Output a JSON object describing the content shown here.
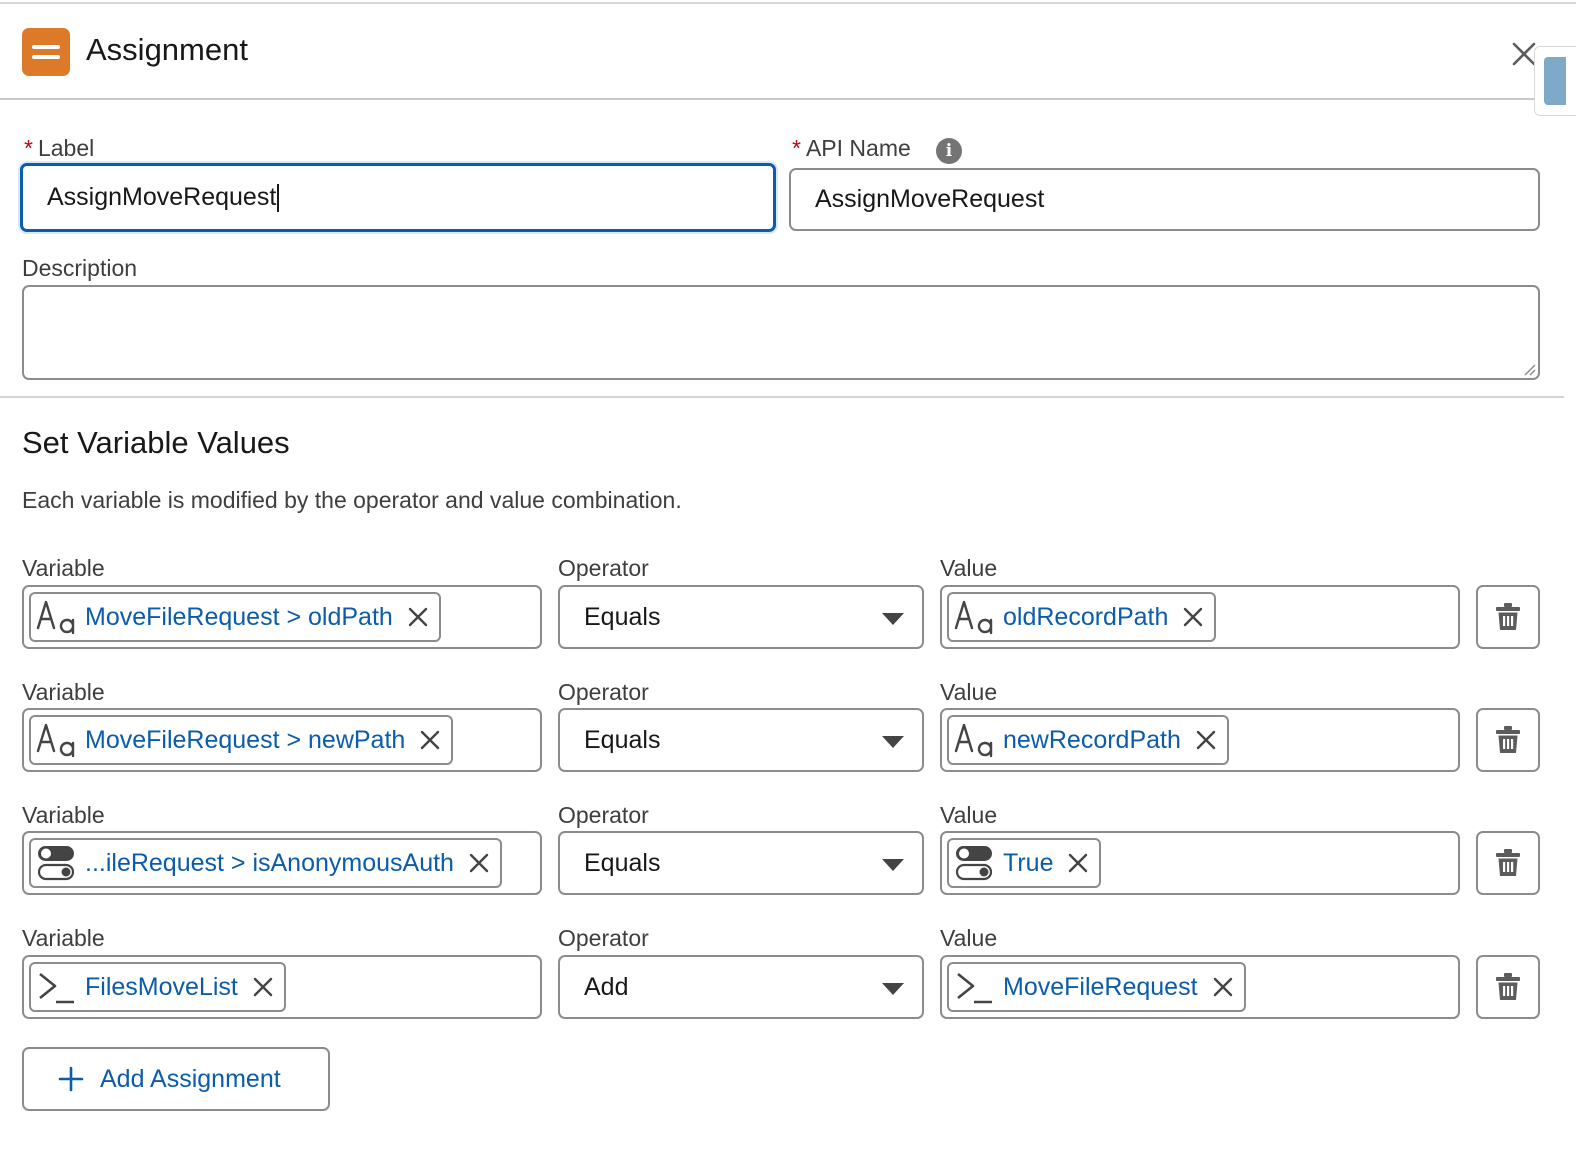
{
  "header": {
    "title": "Assignment",
    "icon": "assignment-icon",
    "accent_color": "#dd7a2a",
    "close_icon": "close-icon"
  },
  "form": {
    "label": {
      "label": "Label",
      "required_mark": "*",
      "value": "AssignMoveRequest"
    },
    "api_name": {
      "label": "API Name",
      "required_mark": "*",
      "value": "AssignMoveRequest",
      "info_icon": "info-icon"
    },
    "description": {
      "label": "Description",
      "value": ""
    }
  },
  "section": {
    "title": "Set Variable Values",
    "description": "Each variable is modified by the operator and value combination."
  },
  "assignments": [
    {
      "variable_label": "Variable",
      "variable_value": "MoveFileRequest > oldPath",
      "variable_icon": "text-icon",
      "operator_label": "Operator",
      "operator_value": "Equals",
      "value_label": "Value",
      "value_value": "oldRecordPath",
      "value_icon": "text-icon"
    },
    {
      "variable_label": "Variable",
      "variable_value": "MoveFileRequest > newPath",
      "variable_icon": "text-icon",
      "operator_label": "Operator",
      "operator_value": "Equals",
      "value_label": "Value",
      "value_value": "newRecordPath",
      "value_icon": "text-icon"
    },
    {
      "variable_label": "Variable",
      "variable_value": "...ileRequest > isAnonymousAuth",
      "variable_icon": "toggle-icon",
      "operator_label": "Operator",
      "operator_value": "Equals",
      "value_label": "Value",
      "value_value": "True",
      "value_icon": "toggle-icon"
    },
    {
      "variable_label": "Variable",
      "variable_value": "FilesMoveList",
      "variable_icon": "apex-icon",
      "operator_label": "Operator",
      "operator_value": "Add",
      "value_label": "Value",
      "value_value": "MoveFileRequest",
      "value_icon": "apex-icon"
    }
  ],
  "add_button": {
    "label": "Add Assignment",
    "icon": "plus-icon"
  },
  "colors": {
    "link": "#0b5cab",
    "focus": "#0b5cab",
    "required": "#ba0517",
    "border": "#8c8c8c"
  }
}
